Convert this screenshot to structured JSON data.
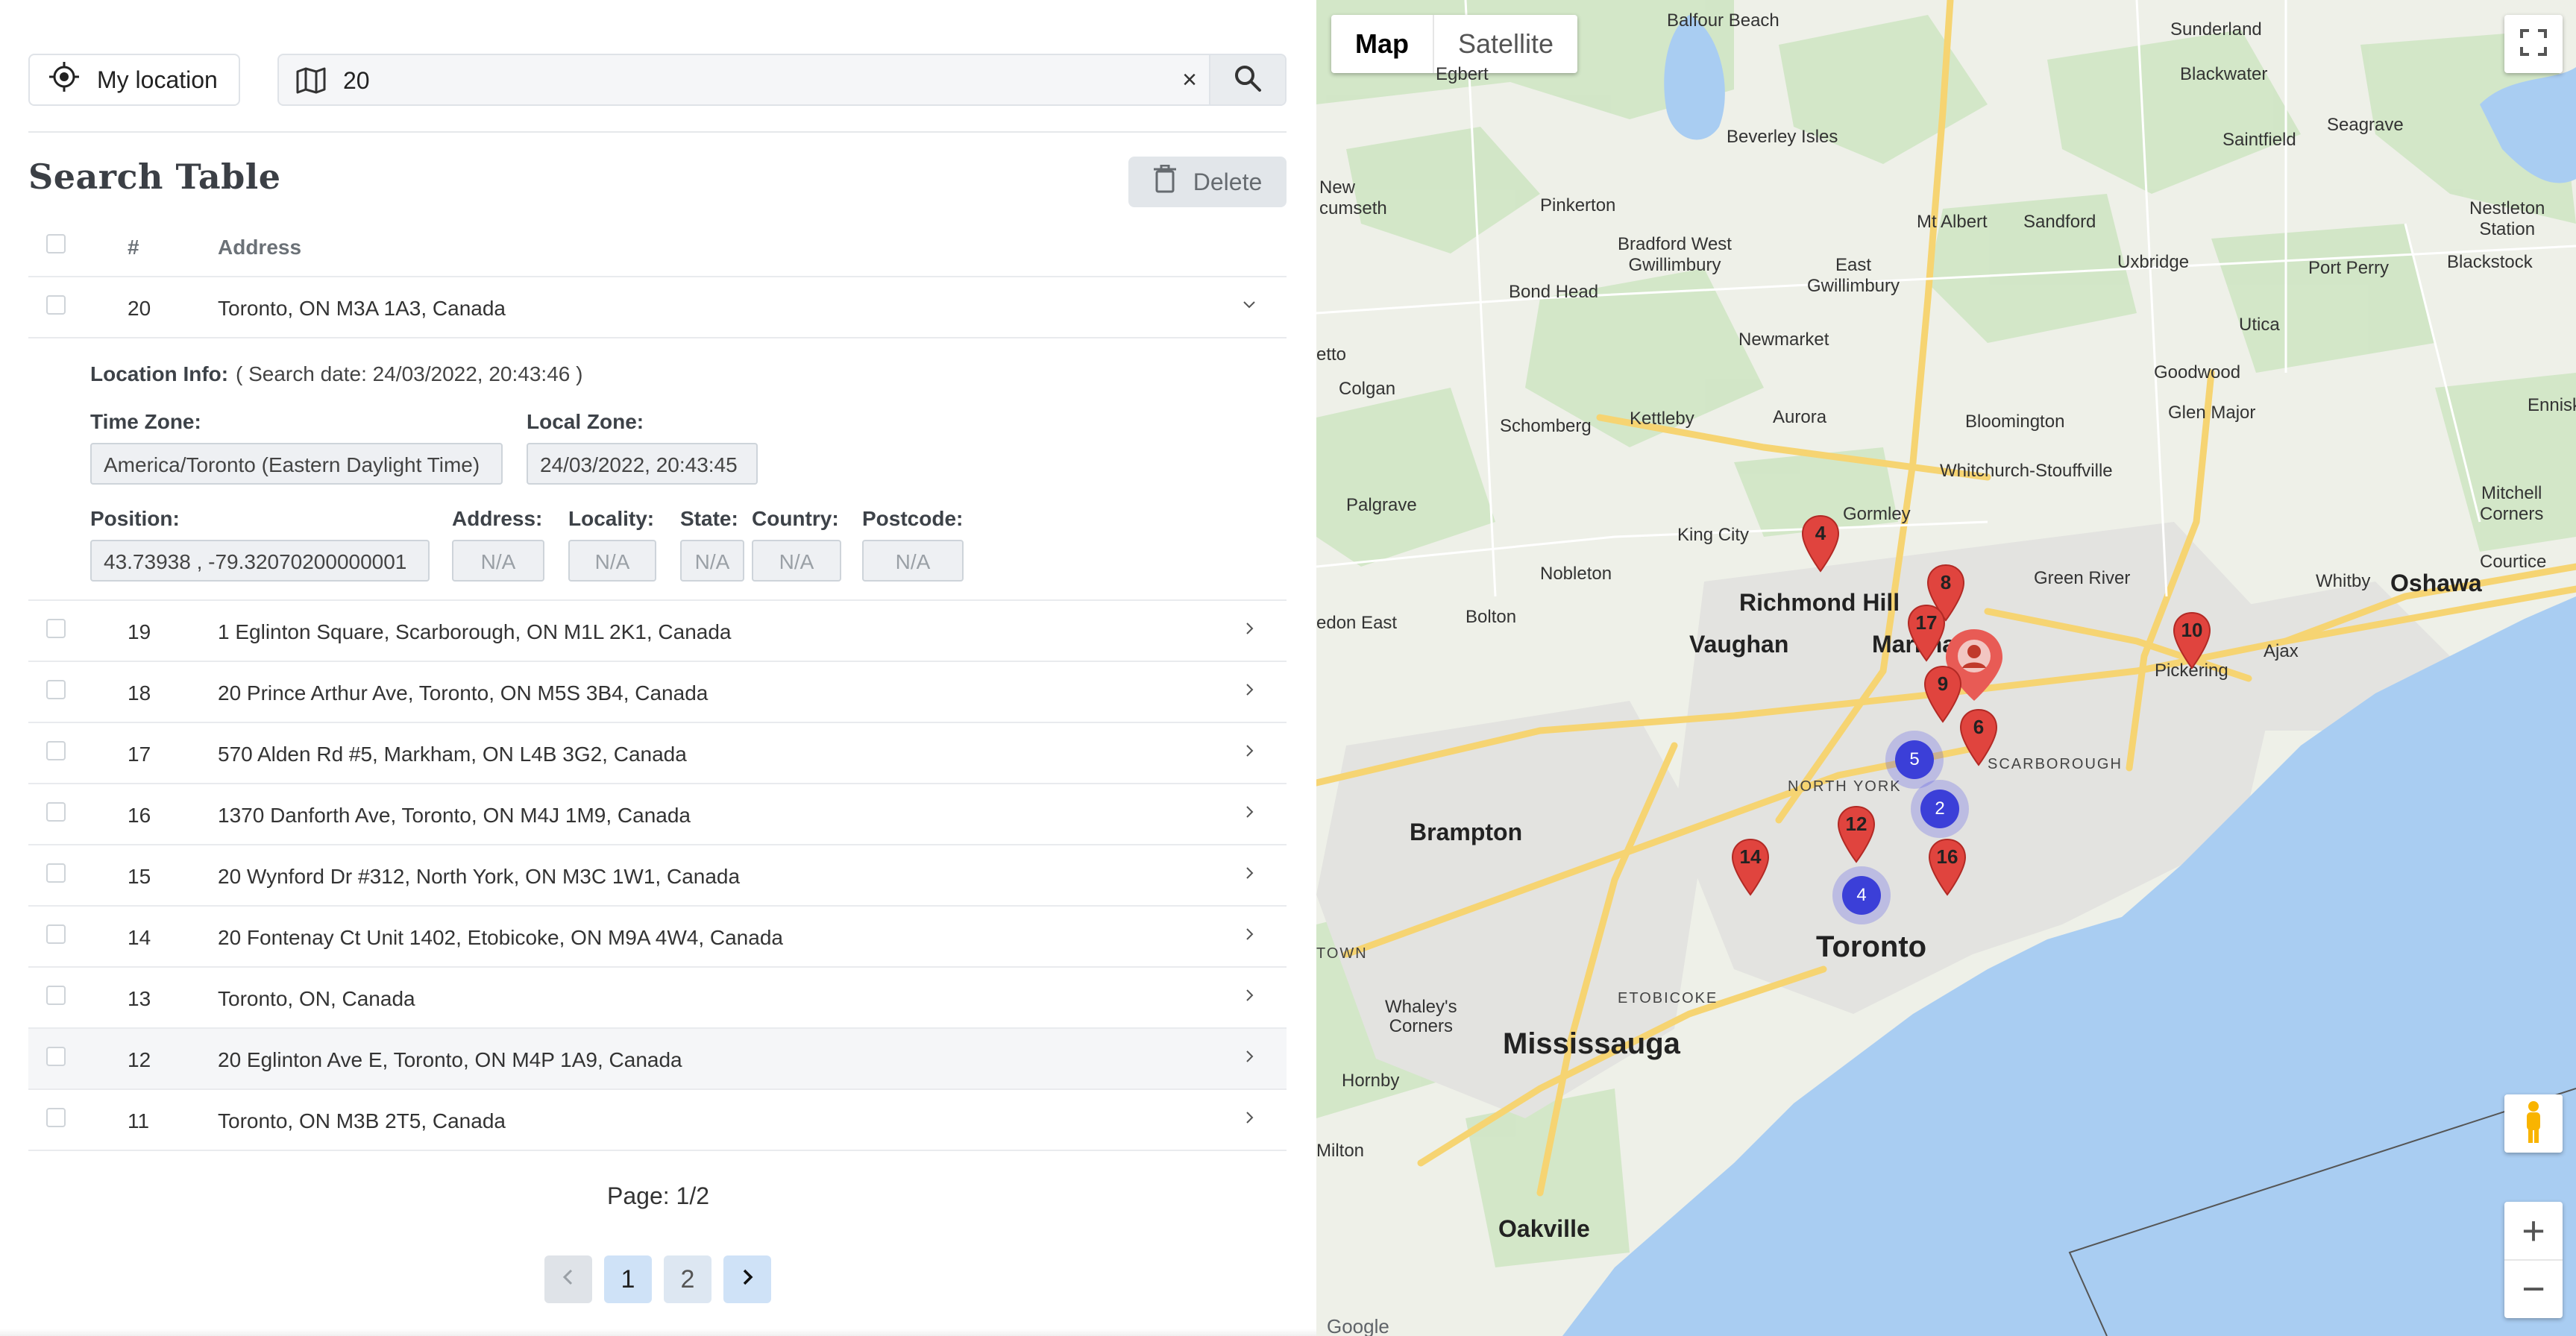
{
  "toolbar": {
    "my_location_label": "My location",
    "search_value": "20",
    "clear_glyph": "×"
  },
  "table": {
    "title": "Search Table",
    "delete_label": "Delete",
    "columns": {
      "index": "#",
      "address": "Address"
    },
    "rows": [
      {
        "num": "20",
        "address": "Toronto, ON M3A 1A3, Canada",
        "expanded": true
      },
      {
        "num": "19",
        "address": "1 Eglinton Square, Scarborough, ON M1L 2K1, Canada"
      },
      {
        "num": "18",
        "address": "20 Prince Arthur Ave, Toronto, ON M5S 3B4, Canada"
      },
      {
        "num": "17",
        "address": "570 Alden Rd #5, Markham, ON L4B 3G2, Canada"
      },
      {
        "num": "16",
        "address": "1370 Danforth Ave, Toronto, ON M4J 1M9, Canada"
      },
      {
        "num": "15",
        "address": "20 Wynford Dr #312, North York, ON M3C 1W1, Canada"
      },
      {
        "num": "14",
        "address": "20 Fontenay Ct Unit 1402, Etobicoke, ON M9A 4W4, Canada"
      },
      {
        "num": "13",
        "address": "Toronto, ON, Canada"
      },
      {
        "num": "12",
        "address": "20 Eglinton Ave E, Toronto, ON M4P 1A9, Canada",
        "highlighted": true
      },
      {
        "num": "11",
        "address": "Toronto, ON M3B 2T5, Canada"
      }
    ]
  },
  "details": {
    "location_info_label": "Location Info:",
    "search_date_text": "( Search date: 24/03/2022, 20:43:46 )",
    "time_zone_label": "Time Zone:",
    "time_zone_value": "America/Toronto (Eastern Daylight Time)",
    "local_zone_label": "Local Zone:",
    "local_zone_value": "24/03/2022, 20:43:45",
    "position_label": "Position:",
    "position_value": "43.73938 , -79.32070200000001",
    "address_label": "Address:",
    "address_value": "N/A",
    "locality_label": "Locality:",
    "locality_value": "N/A",
    "state_label": "State:",
    "state_value": "N/A",
    "country_label": "Country:",
    "country_value": "N/A",
    "postcode_label": "Postcode:",
    "postcode_value": "N/A"
  },
  "pagination": {
    "page_label": "Page: 1/2",
    "pages": [
      "1",
      "2"
    ],
    "current_page": "1"
  },
  "map": {
    "map_label": "Map",
    "satellite_label": "Satellite",
    "zoom_in": "+",
    "zoom_out": "−",
    "attribution": "Google",
    "places": {
      "toronto": "Toronto",
      "mississauga": "Mississauga",
      "brampton": "Brampton",
      "vaughan": "Vaughan",
      "richmond_hill": "Richmond Hill",
      "markham": "Markham",
      "oshawa": "Oshawa",
      "oakville": "Oakville",
      "pickering": "Pickering",
      "whitby": "Whitby",
      "ajax": "Ajax",
      "north_york": "NORTH YORK",
      "scarborough": "SCARBOROUGH",
      "etobicoke": "ETOBICOKE",
      "balfour_beach": "Balfour Beach",
      "sunderland": "Sunderland",
      "blackwater": "Blackwater",
      "saintfield": "Saintfield",
      "seagrave": "Seagrave",
      "beverley_isles": "Beverley Isles",
      "pinkerton": "Pinkerton",
      "mt_albert": "Mt Albert",
      "sandford": "Sandford",
      "bradford": "Bradford West\nGwillimbury",
      "east_gwillimbury": "East\nGwillimbury",
      "uxbridge": "Uxbridge",
      "port_perry": "Port Perry",
      "blackstock": "Blackstock",
      "nestleton": "Nestleton\nStation",
      "bond_head": "Bond Head",
      "newmarket": "Newmarket",
      "utica": "Utica",
      "colgan": "Colgan",
      "goodwood": "Goodwood",
      "schomberg": "Schomberg",
      "kettleby": "Kettleby",
      "aurora": "Aurora",
      "bloomington": "Bloomington",
      "glen_major": "Glen Major",
      "enniskillen": "Enniskiller",
      "whitchurch": "Whitchurch-Stouffville",
      "palgrave": "Palgrave",
      "gormley": "Gormley",
      "king_city": "King City",
      "mitchell_corners": "Mitchell\nCorners",
      "courtice": "Courtice",
      "nobleton": "Nobleton",
      "green_river": "Green River",
      "bolton": "Bolton",
      "caledon_east": "edon East",
      "new_tecumseth": "New\ncumseth",
      "egbert": "Egbert",
      "whaleys_corners": "Whaley's\nCorners",
      "hornby": "Hornby",
      "milton": "Milton",
      "town": "TOWN",
      "etto": "etto"
    },
    "markers": [
      "4",
      "8",
      "17",
      "9",
      "6",
      "10",
      "12",
      "14",
      "16"
    ],
    "clusters": [
      "5",
      "2",
      "4"
    ],
    "colors": {
      "water": "#a9cdf2",
      "land": "#eef0e8",
      "green": "#cfe6c4",
      "urban": "#e3e3e0",
      "highway": "#f6d472",
      "marker": "#e0443e",
      "cluster": "#3b3fd8"
    }
  }
}
